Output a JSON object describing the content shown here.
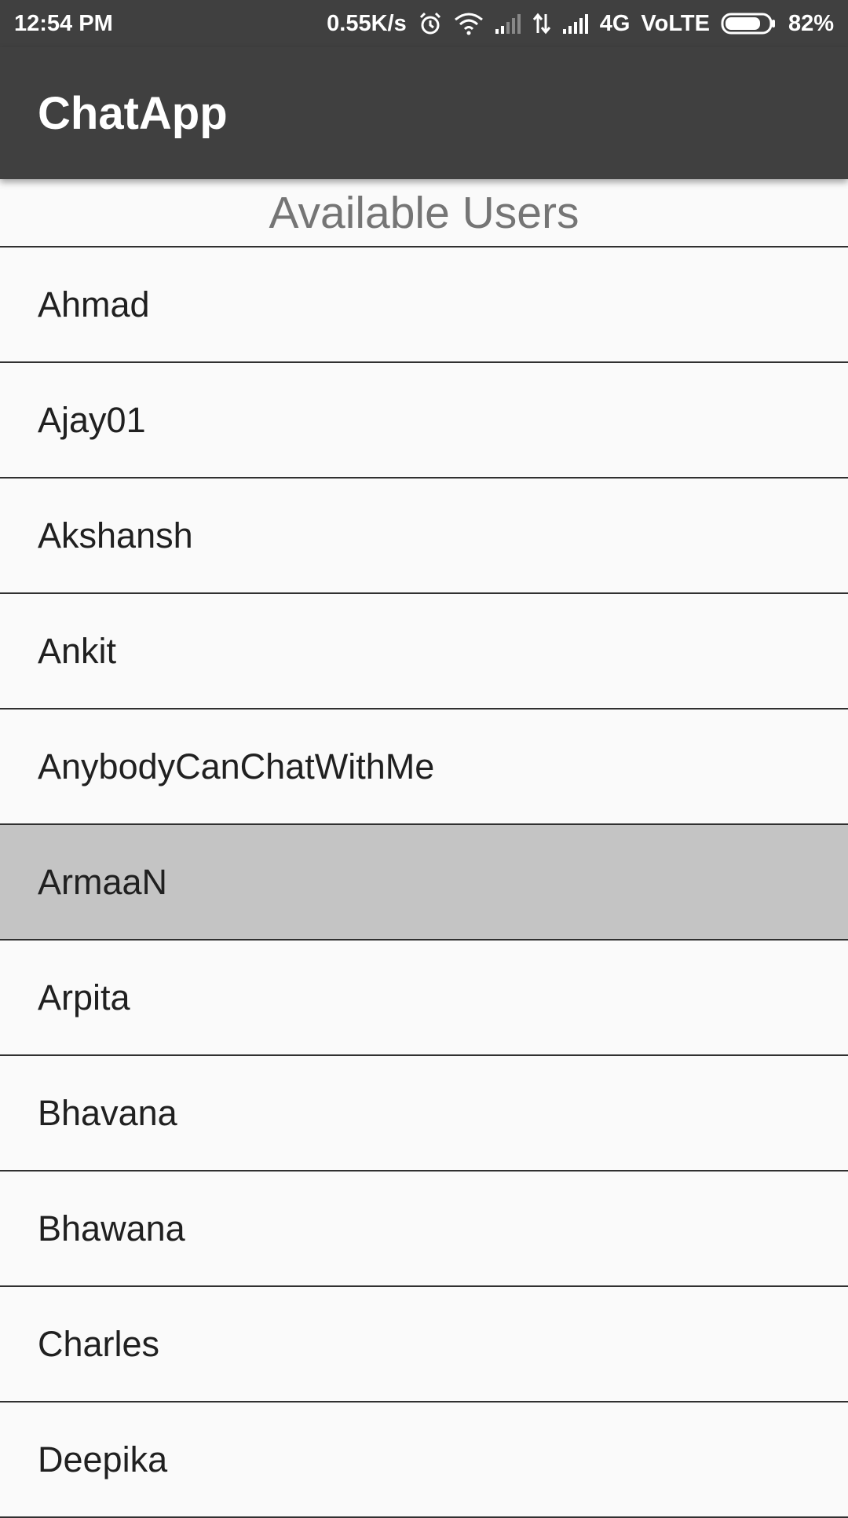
{
  "status_bar": {
    "time": "12:54 PM",
    "network_speed": "0.55K/s",
    "network_type": "4G",
    "volte": "VoLTE",
    "battery_percent": "82%",
    "battery_level": 0.82,
    "icons": [
      "alarm-icon",
      "wifi-icon",
      "signal-icon",
      "data-transfer-icon",
      "signal-icon",
      "battery-icon"
    ]
  },
  "app_bar": {
    "title": "ChatApp"
  },
  "list_header": "Available Users",
  "users": [
    {
      "name": "Ahmad",
      "selected": false
    },
    {
      "name": "Ajay01",
      "selected": false
    },
    {
      "name": "Akshansh",
      "selected": false
    },
    {
      "name": "Ankit",
      "selected": false
    },
    {
      "name": "AnybodyCanChatWithMe",
      "selected": false
    },
    {
      "name": "ArmaaN",
      "selected": true
    },
    {
      "name": "Arpita",
      "selected": false
    },
    {
      "name": "Bhavana",
      "selected": false
    },
    {
      "name": "Bhawana",
      "selected": false
    },
    {
      "name": "Charles",
      "selected": false
    },
    {
      "name": "Deepika",
      "selected": false
    }
  ],
  "colors": {
    "app_bar": "#404040",
    "background": "#fafafa",
    "selected_row": "#c4c4c4",
    "divider": "#303030",
    "header_text": "#757575"
  }
}
